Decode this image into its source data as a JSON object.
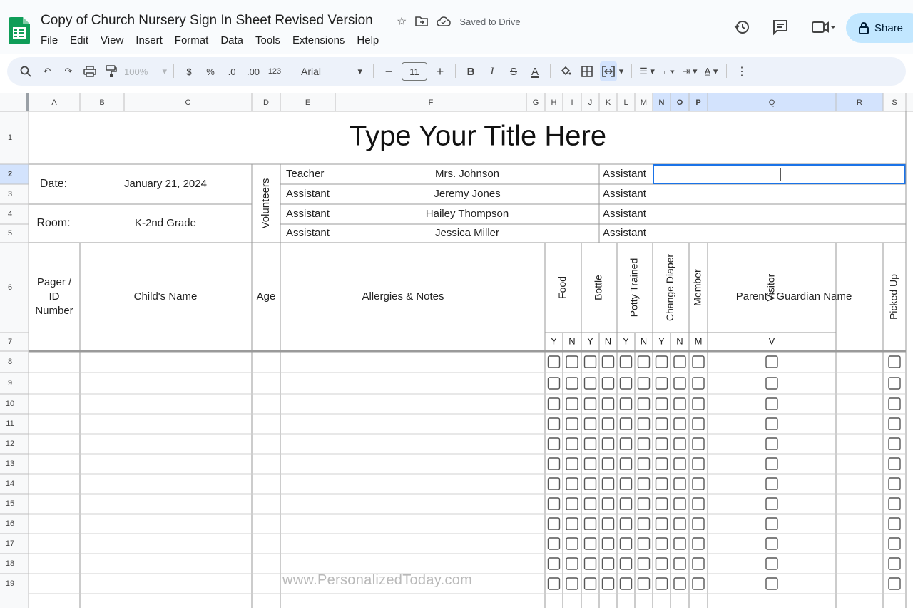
{
  "app": {
    "doc_title": "Copy of Church Nursery Sign In Sheet Revised Version",
    "saved_status": "Saved to Drive",
    "share_label": "Share",
    "menus": [
      "File",
      "Edit",
      "View",
      "Insert",
      "Format",
      "Data",
      "Tools",
      "Extensions",
      "Help"
    ]
  },
  "toolbar": {
    "zoom": "100%",
    "currency": "$",
    "percent": "%",
    "decrease_decimal": ".0",
    "increase_decimal": ".00",
    "number_format": "123",
    "font": "Arial",
    "font_size": "11",
    "bold": "B",
    "italic": "I",
    "strikethrough": "S",
    "text_color": "A"
  },
  "columns": [
    "A",
    "B",
    "C",
    "D",
    "E",
    "F",
    "G",
    "H",
    "I",
    "J",
    "K",
    "L",
    "M",
    "N",
    "O",
    "P",
    "Q",
    "R",
    "S"
  ],
  "rows": [
    "1",
    "2",
    "3",
    "4",
    "5",
    "6",
    "7",
    "8",
    "9",
    "10",
    "11",
    "12",
    "13",
    "14",
    "15",
    "16",
    "17",
    "18",
    "19"
  ],
  "sheet": {
    "title": "Type Your Title Here",
    "date_label": "Date:",
    "date_value": "January 21, 2024",
    "room_label": "Room:",
    "room_value": "K-2nd Grade",
    "volunteers_label": "Volunteers",
    "volunteers": [
      {
        "role": "Teacher",
        "name": "Mrs. Johnson"
      },
      {
        "role": "Assistant",
        "name": "Jeremy Jones"
      },
      {
        "role": "Assistant",
        "name": "Hailey Thompson"
      },
      {
        "role": "Assistant",
        "name": "Jessica Miller"
      }
    ],
    "right_assistants": [
      "Assistant",
      "Assistant",
      "Assistant",
      "Assistant"
    ],
    "headers": {
      "pager": [
        "Pager /",
        "ID",
        "Number"
      ],
      "child_name": "Child's Name",
      "age": "Age",
      "allergies": "Allergies & Notes",
      "food": "Food",
      "bottle": "Bottle",
      "potty": "Potty Trained",
      "diaper": "Change Diaper",
      "member": "Member",
      "visitor": "Visitor",
      "parent": "Parent / Guardian Name",
      "picked_up": "Picked Up"
    },
    "sub_headers": [
      "Y",
      "N",
      "Y",
      "N",
      "Y",
      "N",
      "Y",
      "N",
      "M",
      "V"
    ]
  },
  "watermark": "www.PersonalizedToday.com"
}
